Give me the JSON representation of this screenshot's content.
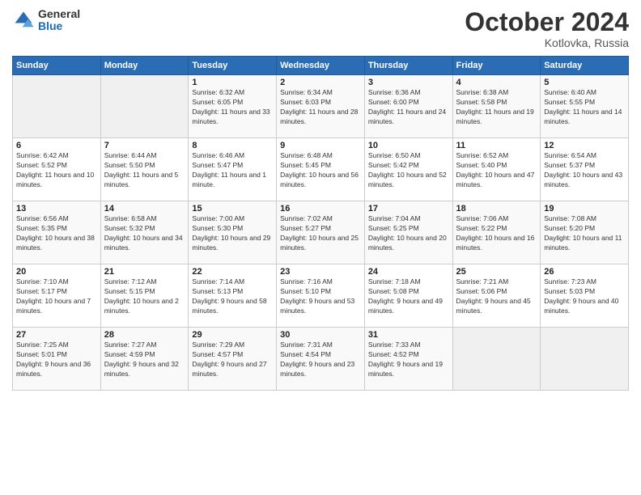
{
  "logo": {
    "general": "General",
    "blue": "Blue"
  },
  "header": {
    "month": "October 2024",
    "location": "Kotlovka, Russia"
  },
  "weekdays": [
    "Sunday",
    "Monday",
    "Tuesday",
    "Wednesday",
    "Thursday",
    "Friday",
    "Saturday"
  ],
  "weeks": [
    [
      {
        "day": "",
        "sunrise": "",
        "sunset": "",
        "daylight": ""
      },
      {
        "day": "",
        "sunrise": "",
        "sunset": "",
        "daylight": ""
      },
      {
        "day": "1",
        "sunrise": "Sunrise: 6:32 AM",
        "sunset": "Sunset: 6:05 PM",
        "daylight": "Daylight: 11 hours and 33 minutes."
      },
      {
        "day": "2",
        "sunrise": "Sunrise: 6:34 AM",
        "sunset": "Sunset: 6:03 PM",
        "daylight": "Daylight: 11 hours and 28 minutes."
      },
      {
        "day": "3",
        "sunrise": "Sunrise: 6:36 AM",
        "sunset": "Sunset: 6:00 PM",
        "daylight": "Daylight: 11 hours and 24 minutes."
      },
      {
        "day": "4",
        "sunrise": "Sunrise: 6:38 AM",
        "sunset": "Sunset: 5:58 PM",
        "daylight": "Daylight: 11 hours and 19 minutes."
      },
      {
        "day": "5",
        "sunrise": "Sunrise: 6:40 AM",
        "sunset": "Sunset: 5:55 PM",
        "daylight": "Daylight: 11 hours and 14 minutes."
      }
    ],
    [
      {
        "day": "6",
        "sunrise": "Sunrise: 6:42 AM",
        "sunset": "Sunset: 5:52 PM",
        "daylight": "Daylight: 11 hours and 10 minutes."
      },
      {
        "day": "7",
        "sunrise": "Sunrise: 6:44 AM",
        "sunset": "Sunset: 5:50 PM",
        "daylight": "Daylight: 11 hours and 5 minutes."
      },
      {
        "day": "8",
        "sunrise": "Sunrise: 6:46 AM",
        "sunset": "Sunset: 5:47 PM",
        "daylight": "Daylight: 11 hours and 1 minute."
      },
      {
        "day": "9",
        "sunrise": "Sunrise: 6:48 AM",
        "sunset": "Sunset: 5:45 PM",
        "daylight": "Daylight: 10 hours and 56 minutes."
      },
      {
        "day": "10",
        "sunrise": "Sunrise: 6:50 AM",
        "sunset": "Sunset: 5:42 PM",
        "daylight": "Daylight: 10 hours and 52 minutes."
      },
      {
        "day": "11",
        "sunrise": "Sunrise: 6:52 AM",
        "sunset": "Sunset: 5:40 PM",
        "daylight": "Daylight: 10 hours and 47 minutes."
      },
      {
        "day": "12",
        "sunrise": "Sunrise: 6:54 AM",
        "sunset": "Sunset: 5:37 PM",
        "daylight": "Daylight: 10 hours and 43 minutes."
      }
    ],
    [
      {
        "day": "13",
        "sunrise": "Sunrise: 6:56 AM",
        "sunset": "Sunset: 5:35 PM",
        "daylight": "Daylight: 10 hours and 38 minutes."
      },
      {
        "day": "14",
        "sunrise": "Sunrise: 6:58 AM",
        "sunset": "Sunset: 5:32 PM",
        "daylight": "Daylight: 10 hours and 34 minutes."
      },
      {
        "day": "15",
        "sunrise": "Sunrise: 7:00 AM",
        "sunset": "Sunset: 5:30 PM",
        "daylight": "Daylight: 10 hours and 29 minutes."
      },
      {
        "day": "16",
        "sunrise": "Sunrise: 7:02 AM",
        "sunset": "Sunset: 5:27 PM",
        "daylight": "Daylight: 10 hours and 25 minutes."
      },
      {
        "day": "17",
        "sunrise": "Sunrise: 7:04 AM",
        "sunset": "Sunset: 5:25 PM",
        "daylight": "Daylight: 10 hours and 20 minutes."
      },
      {
        "day": "18",
        "sunrise": "Sunrise: 7:06 AM",
        "sunset": "Sunset: 5:22 PM",
        "daylight": "Daylight: 10 hours and 16 minutes."
      },
      {
        "day": "19",
        "sunrise": "Sunrise: 7:08 AM",
        "sunset": "Sunset: 5:20 PM",
        "daylight": "Daylight: 10 hours and 11 minutes."
      }
    ],
    [
      {
        "day": "20",
        "sunrise": "Sunrise: 7:10 AM",
        "sunset": "Sunset: 5:17 PM",
        "daylight": "Daylight: 10 hours and 7 minutes."
      },
      {
        "day": "21",
        "sunrise": "Sunrise: 7:12 AM",
        "sunset": "Sunset: 5:15 PM",
        "daylight": "Daylight: 10 hours and 2 minutes."
      },
      {
        "day": "22",
        "sunrise": "Sunrise: 7:14 AM",
        "sunset": "Sunset: 5:13 PM",
        "daylight": "Daylight: 9 hours and 58 minutes."
      },
      {
        "day": "23",
        "sunrise": "Sunrise: 7:16 AM",
        "sunset": "Sunset: 5:10 PM",
        "daylight": "Daylight: 9 hours and 53 minutes."
      },
      {
        "day": "24",
        "sunrise": "Sunrise: 7:18 AM",
        "sunset": "Sunset: 5:08 PM",
        "daylight": "Daylight: 9 hours and 49 minutes."
      },
      {
        "day": "25",
        "sunrise": "Sunrise: 7:21 AM",
        "sunset": "Sunset: 5:06 PM",
        "daylight": "Daylight: 9 hours and 45 minutes."
      },
      {
        "day": "26",
        "sunrise": "Sunrise: 7:23 AM",
        "sunset": "Sunset: 5:03 PM",
        "daylight": "Daylight: 9 hours and 40 minutes."
      }
    ],
    [
      {
        "day": "27",
        "sunrise": "Sunrise: 7:25 AM",
        "sunset": "Sunset: 5:01 PM",
        "daylight": "Daylight: 9 hours and 36 minutes."
      },
      {
        "day": "28",
        "sunrise": "Sunrise: 7:27 AM",
        "sunset": "Sunset: 4:59 PM",
        "daylight": "Daylight: 9 hours and 32 minutes."
      },
      {
        "day": "29",
        "sunrise": "Sunrise: 7:29 AM",
        "sunset": "Sunset: 4:57 PM",
        "daylight": "Daylight: 9 hours and 27 minutes."
      },
      {
        "day": "30",
        "sunrise": "Sunrise: 7:31 AM",
        "sunset": "Sunset: 4:54 PM",
        "daylight": "Daylight: 9 hours and 23 minutes."
      },
      {
        "day": "31",
        "sunrise": "Sunrise: 7:33 AM",
        "sunset": "Sunset: 4:52 PM",
        "daylight": "Daylight: 9 hours and 19 minutes."
      },
      {
        "day": "",
        "sunrise": "",
        "sunset": "",
        "daylight": ""
      },
      {
        "day": "",
        "sunrise": "",
        "sunset": "",
        "daylight": ""
      }
    ]
  ]
}
